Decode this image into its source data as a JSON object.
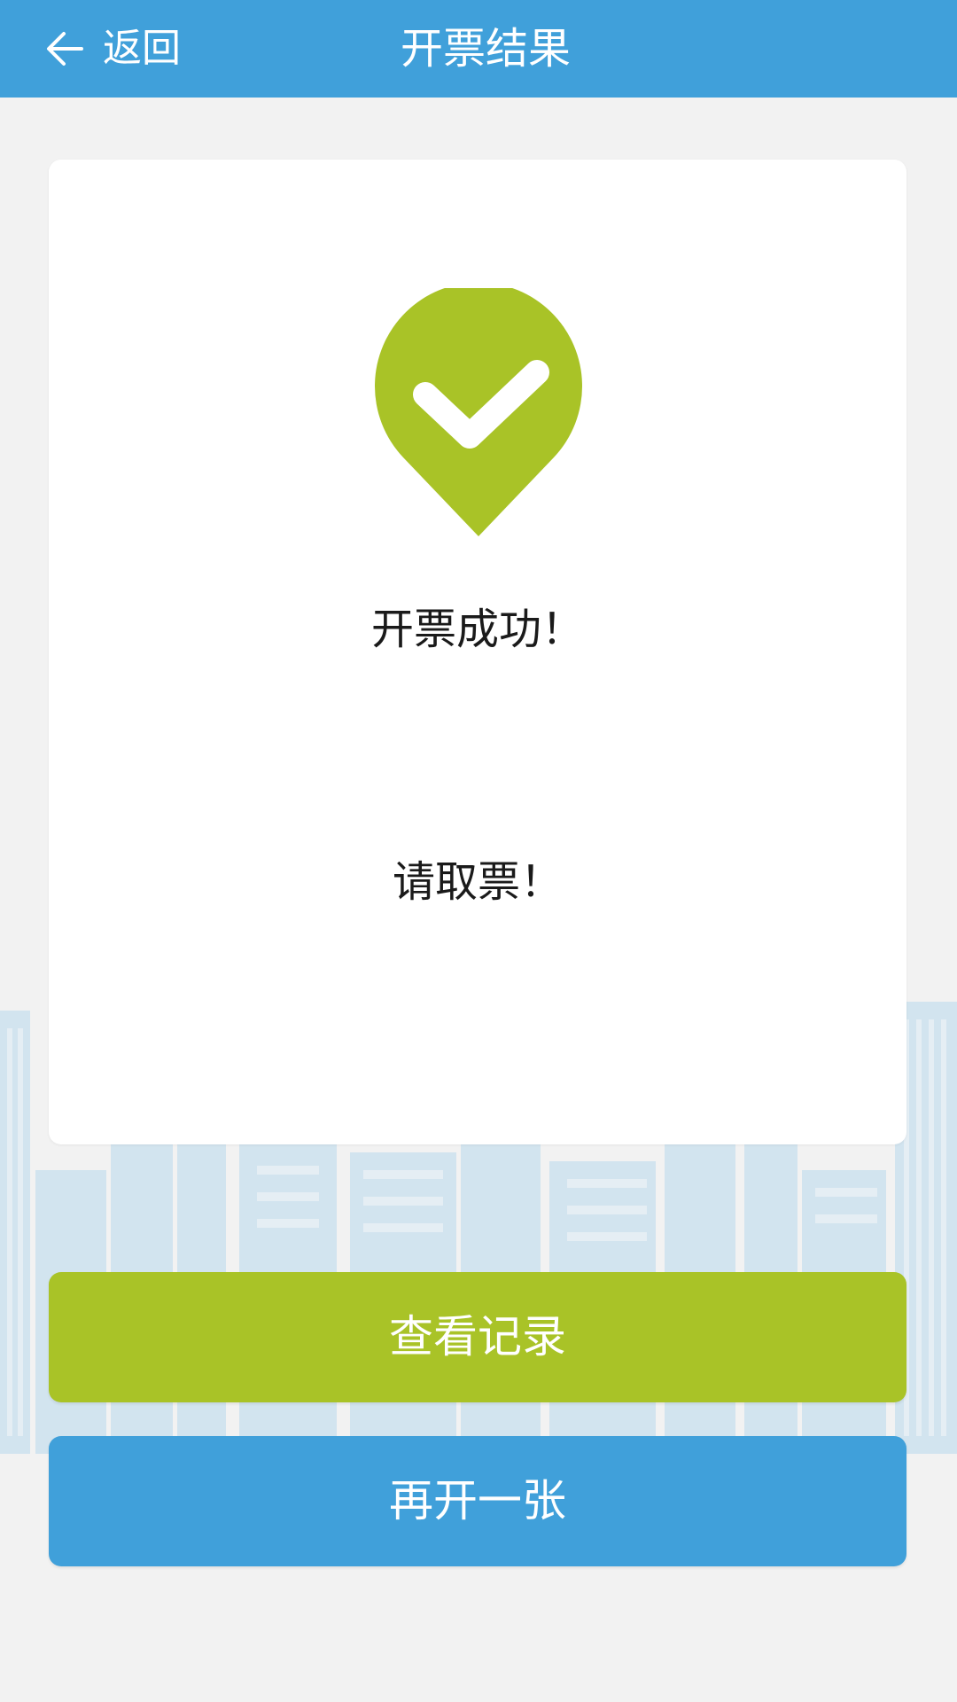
{
  "header": {
    "back_label": "返回",
    "title": "开票结果",
    "background": "#40a0da",
    "back_icon": "arrow-left-icon"
  },
  "card": {
    "icon": "check-pin-icon",
    "icon_color": "#a9c327",
    "success_text": "开票成功！",
    "instruction_text": "请取票！"
  },
  "buttons": {
    "view_records": "查看记录",
    "view_records_color": "#a9c327",
    "issue_another": "再开一张",
    "issue_another_color": "#40a0da"
  }
}
